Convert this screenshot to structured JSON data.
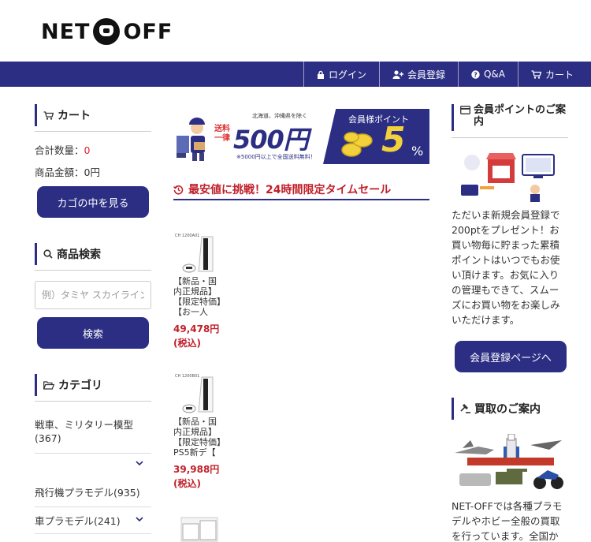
{
  "logo": {
    "left": "NET",
    "right": "OFF"
  },
  "nav": {
    "login": "ログイン",
    "register": "会員登録",
    "qa": "Q&A",
    "cart": "カート"
  },
  "sidebar": {
    "cart_title": "カート",
    "qty_label": "合計数量：",
    "qty_value": "0",
    "amount_label": "商品金額：0円",
    "view_cart_button": "カゴの中を見る",
    "search_title": "商品検索",
    "search_placeholder": "例）タミヤ スカイライン",
    "search_button": "検索",
    "category_title": "カテゴリ",
    "categories": [
      "戦車、ミリタリー模型(367)",
      "飛行機プラモデル(935)",
      "車プラモデル(241)"
    ]
  },
  "banner": {
    "note_top": "北海道、沖縄県を除く",
    "shipping_label": "送料一律",
    "shipping_amount": "500円",
    "note_bottom": "※5000円以上で全国送料無料！",
    "points_label": "会員様ポイント",
    "points_rate": "5",
    "points_unit": "%"
  },
  "sale": {
    "heading": "最安値に挑戦！24時間限定タイムセール",
    "products": [
      {
        "name": "【新品・国内正規品】【限定特価】【お一人",
        "price": "49,478円(税込)",
        "tag": "CH 1200A01"
      },
      {
        "name": "【新品・国内正規品】【限定特価】PS5新デ【",
        "price": "39,988円(税込)",
        "tag": "CH 1200B01"
      }
    ]
  },
  "right": {
    "points_title": "会員ポイントのご案内",
    "points_text": "ただいま新規会員登録で200ptをプレゼント！お買い物毎に貯まった累積ポイントはいつでもお使い頂けます。お気に入りの管理もできて、スムーズにお買い物をお楽しみいただけます。",
    "register_button": "会員登録ページへ",
    "buyback_title": "買取のご案内",
    "buyback_text": "NET-OFFでは各種プラモデルやホビー全般の買取を行っています。全国か"
  },
  "colors": {
    "brand": "#2b2e83",
    "sale_red": "#c0202a"
  }
}
